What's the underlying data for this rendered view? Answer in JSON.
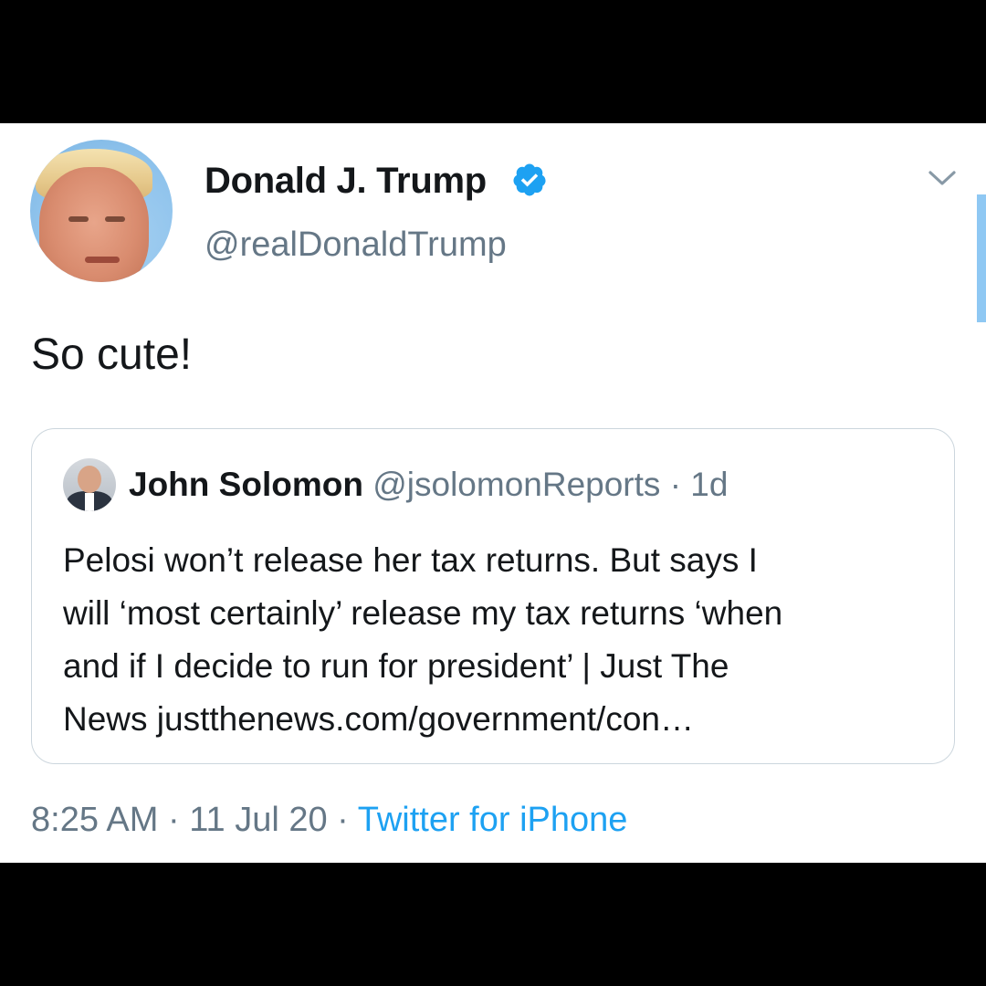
{
  "tweet": {
    "author": {
      "display_name": "Donald J. Trump",
      "handle": "@realDonaldTrump",
      "verified": true
    },
    "text": "So cute!",
    "quoted_tweet": {
      "author_name": "John Solomon",
      "author_handle": "@jsolomonReports",
      "separator": "·",
      "age": "1d",
      "text_lines": [
        "Pelosi won’t release her tax returns. But says I",
        "will ‘most certainly’ release my tax returns ‘when",
        "and if I decide to run for president’ | Just The",
        "News justthenews.com/government/con…"
      ]
    },
    "meta": {
      "time": "8:25 AM",
      "separator": "·",
      "date": "11 Jul 20",
      "source": "Twitter for iPhone"
    }
  },
  "icons": {
    "verified": "verified-badge-icon",
    "menu": "chevron-down-icon"
  },
  "colors": {
    "background_frame": "#000000",
    "card": "#ffffff",
    "text_primary": "#14171a",
    "text_secondary": "#657786",
    "accent": "#1da1f2",
    "border": "#ccd6dd"
  }
}
